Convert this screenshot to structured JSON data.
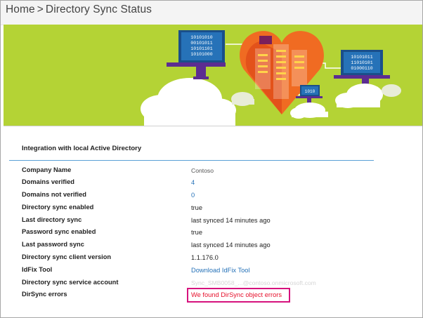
{
  "header": {
    "home_label": "Home",
    "separator": ">",
    "page_title": "Directory Sync Status"
  },
  "banner": {
    "laptop_left_lines": [
      "10101010",
      "00101011",
      "10101101",
      "10101000"
    ],
    "laptop_right_lines": [
      "10101011",
      "11010101",
      "01000110"
    ],
    "small_laptop_text": "1010",
    "colors": {
      "background": "#b4d335",
      "orange": "#f06b22",
      "purple": "#5c2d91",
      "blue": "#0072c6",
      "green": "#7ab800"
    }
  },
  "section": {
    "title": "Integration with local Active Directory"
  },
  "rows": [
    {
      "label": "Company Name",
      "value": "Contoso"
    },
    {
      "label": "Domains verified",
      "value": "4"
    },
    {
      "label": "Domains not verified",
      "value": "0"
    },
    {
      "label": "Directory sync enabled",
      "value": "true"
    },
    {
      "label": "Last directory sync",
      "value": "last synced 14 minutes ago"
    },
    {
      "label": "Password sync enabled",
      "value": "true"
    },
    {
      "label": "Last password sync",
      "value": "last synced 14 minutes ago"
    },
    {
      "label": "Directory sync client version",
      "value": "1.1.176.0"
    },
    {
      "label": "IdFix Tool",
      "value": "Download IdFix Tool"
    },
    {
      "label": "Directory sync service account",
      "value": "Sync_SMB0058_...@contoso.onmicrosoft.com"
    },
    {
      "label": "DirSync errors",
      "value": "We found DirSync object errors"
    }
  ],
  "colors": {
    "link": "#2672b8",
    "error_text": "#e6102b",
    "highlight_border": "#d6127d",
    "divider": "#5aa0d6"
  }
}
